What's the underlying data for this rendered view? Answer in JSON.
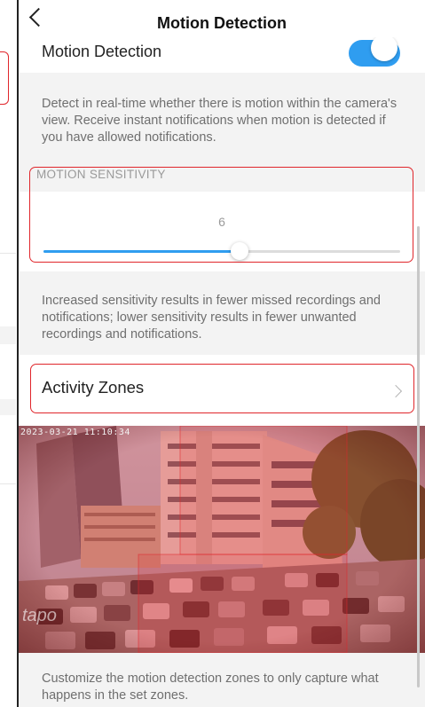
{
  "nav": {
    "title": "Motion Detection",
    "back_icon": "chevron-left-icon"
  },
  "motion": {
    "label": "Motion Detection",
    "enabled": true,
    "toggle_color": "#2f9df0"
  },
  "motion_description": "Detect in real-time whether there is motion within the camera's view. Receive instant notifications when motion is detected if you have allowed notifications.",
  "sensitivity": {
    "header": "MOTION SENSITIVITY",
    "value": "6",
    "level_fraction": 0.55,
    "description": "Increased sensitivity results in fewer missed recordings and notifications; lower sensitivity results in fewer unwanted recordings and notifications."
  },
  "activity_zones": {
    "label": "Activity Zones",
    "chevron_icon": "chevron-right-icon",
    "description": "Customize the motion detection zones to only capture what happens in the set zones."
  },
  "camera": {
    "timestamp": "2023-03-21 11:10:34",
    "watermark": "tapo",
    "zone_color": "#e0262b"
  },
  "highlight_color": "#e0262b"
}
